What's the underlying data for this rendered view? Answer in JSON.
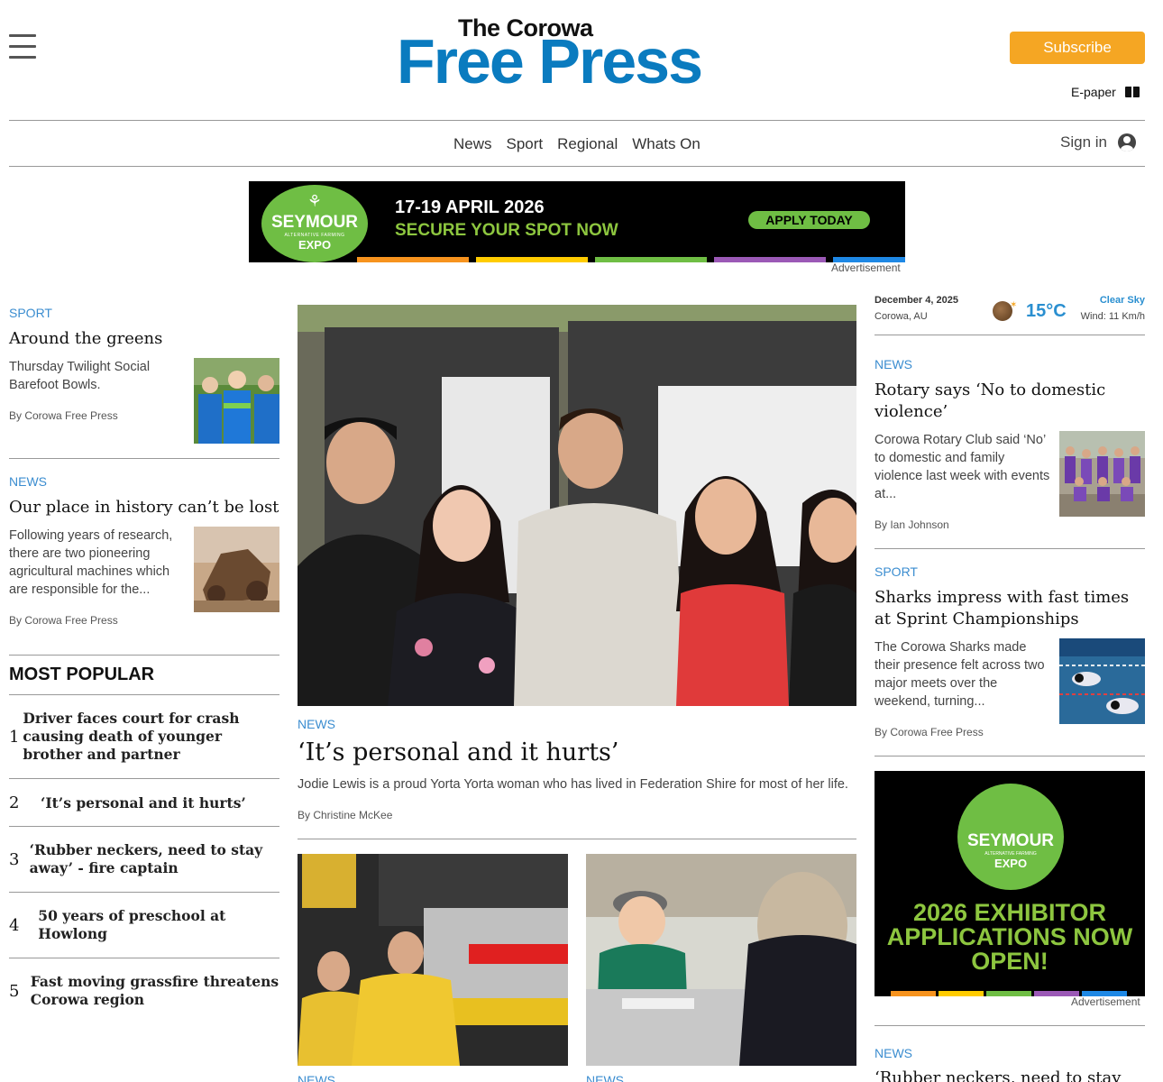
{
  "header": {
    "logo_top": "The Corowa",
    "logo_main": "Free Press",
    "subscribe_label": "Subscribe",
    "epaper_label": "E-paper"
  },
  "nav": {
    "items": [
      "News",
      "Sport",
      "Regional",
      "Whats On"
    ],
    "signin_label": "Sign in"
  },
  "banner_ad": {
    "brand": "SEYMOUR",
    "brand_sub": "ALTERNATIVE FARMING",
    "brand_expo": "EXPO",
    "date": "17-19 APRIL 2026",
    "cta": "SECURE YOUR SPOT NOW",
    "button": "APPLY TODAY",
    "label": "Advertisement"
  },
  "left": {
    "articles": [
      {
        "category": "SPORT",
        "headline": "Around the greens",
        "excerpt": "Thursday Twilight Social Barefoot Bowls.",
        "byline": "By Corowa Free Press"
      },
      {
        "category": "NEWS",
        "headline": "Our place in history can’t be lost",
        "excerpt": "Following years of research, there are two pioneering agricultural machines which are responsible for the...",
        "byline": "By Corowa Free Press"
      }
    ],
    "most_popular_title": "MOST POPULAR",
    "most_popular": [
      {
        "num": "1",
        "title": "Driver faces court for crash causing death of younger brother and partner"
      },
      {
        "num": "2",
        "title": "‘It’s personal and it hurts’"
      },
      {
        "num": "3",
        "title": "‘Rubber neckers, need to stay away’ - fire captain"
      },
      {
        "num": "4",
        "title": "50 years of preschool at Howlong"
      },
      {
        "num": "5",
        "title": "Fast moving grassfire threatens Corowa region"
      }
    ]
  },
  "main": {
    "category": "NEWS",
    "headline": "‘It’s personal and it hurts’",
    "excerpt": "Jodie Lewis is a proud Yorta Yorta woman who has lived in Federation Shire for most of her life.",
    "byline": "By Christine McKee",
    "sub_categories": [
      "NEWS",
      "NEWS"
    ]
  },
  "weather": {
    "date": "December 4, 2025",
    "location": "Corowa, AU",
    "temp": "15°C",
    "condition": "Clear Sky",
    "wind": "Wind: 11 Km/h"
  },
  "right": {
    "articles": [
      {
        "category": "NEWS",
        "headline": "Rotary says ‘No to domestic violence’",
        "excerpt": "Corowa Rotary Club said ‘No’ to domestic and family violence last week with events at...",
        "byline": "By Ian Johnson"
      },
      {
        "category": "SPORT",
        "headline": "Sharks impress with fast times at Sprint Championships",
        "excerpt": "The Corowa Sharks made their presence felt across two major meets over the weekend, turning...",
        "byline": "By Corowa Free Press"
      }
    ],
    "ad": {
      "brand": "SEYMOUR",
      "brand_sub": "ALTERNATIVE FARMING",
      "brand_expo": "EXPO",
      "text": "2026 EXHIBITOR APPLICATIONS NOW OPEN!",
      "label": "Advertisement"
    },
    "bottom_category": "NEWS",
    "bottom_headline": "‘Rubber neckers, need to stay"
  },
  "colors": {
    "accent_blue": "#0a7bbf",
    "category_blue": "#3b8dd0",
    "subscribe_orange": "#f5a623",
    "ad_green": "#6fbe44",
    "ad_stripe": [
      "#f7931e",
      "#ffcc00",
      "#6fbe44",
      "#9b59b6",
      "#1e88e5"
    ]
  }
}
